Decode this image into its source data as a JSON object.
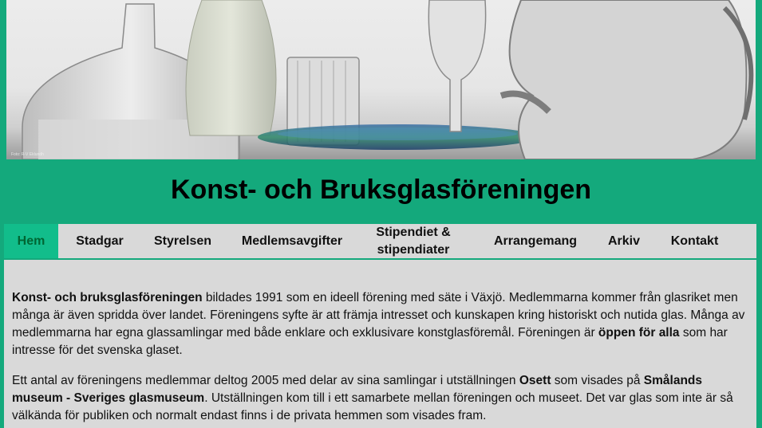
{
  "banner": {
    "image_name": "glass-vessels-photo",
    "credit": "Foto: R-V Eklundh"
  },
  "site": {
    "title": "Konst- och Bruksglasföreningen"
  },
  "nav": {
    "items": [
      {
        "label": "Hem",
        "active": true
      },
      {
        "label": "Stadgar"
      },
      {
        "label": "Styrelsen"
      },
      {
        "label": "Medlemsavgifter"
      },
      {
        "label": "Stipendiet &",
        "label2": "stipendiater"
      },
      {
        "label": "Arrangemang"
      },
      {
        "label": "Arkiv"
      },
      {
        "label": "Kontakt"
      }
    ]
  },
  "content": {
    "p1": {
      "b1": "Konst- och bruksglasföreningen",
      "t1": " bildades 1991 som en ideell förening med säte i Växjö. Medlemmarna kommer från glasriket men många är även spridda över landet. Föreningens syfte är att främja intresset och kunskapen kring historiskt och nutida glas. Många av medlemmarna har egna glassamlingar med både enklare och exklusivare konstglasföremål. Föreningen är ",
      "b2": "öppen för alla",
      "t2": " som har intresse för det svenska glaset."
    },
    "p2": {
      "t1": "Ett antal av föreningens medlemmar deltog 2005 med delar av sina samlingar i utställningen ",
      "b1": "Osett",
      "t2": " som visades på ",
      "b2": "Smålands museum - Sveriges glasmuseum",
      "t3": ". Utställningen kom till i ett samarbete mellan föreningen och museet. Det var glas som inte är så välkända för publiken och normalt endast finns i de privata hemmen som visades fram."
    }
  }
}
